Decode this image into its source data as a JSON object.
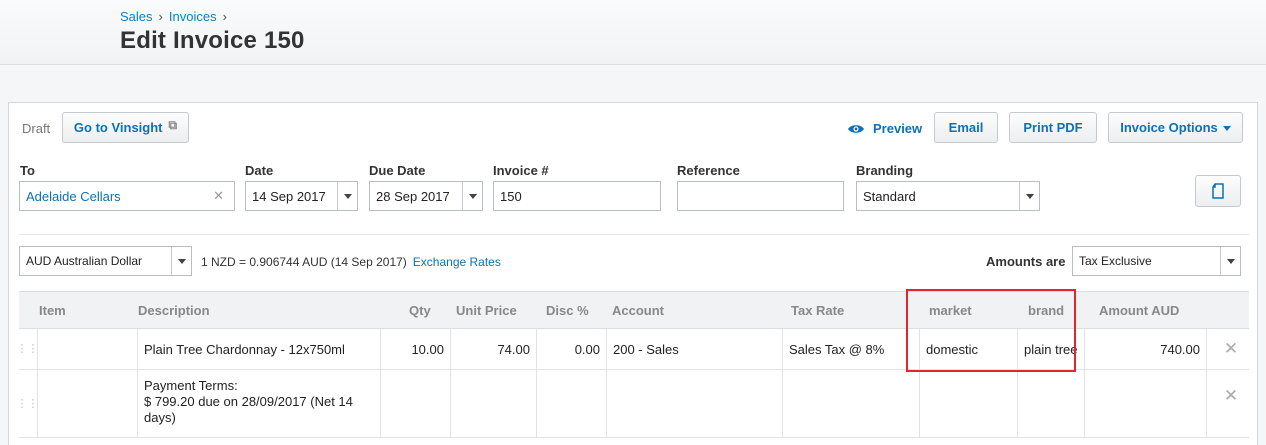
{
  "breadcrumb": {
    "items": [
      "Sales",
      "Invoices"
    ]
  },
  "page": {
    "title": "Edit Invoice 150"
  },
  "toolbar": {
    "status": "Draft",
    "go_to_vinsight": "Go to Vinsight",
    "preview": "Preview",
    "email": "Email",
    "print_pdf": "Print PDF",
    "invoice_options": "Invoice Options"
  },
  "form": {
    "to": {
      "label": "To",
      "value": "Adelaide Cellars"
    },
    "date": {
      "label": "Date",
      "value": "14 Sep 2017"
    },
    "due_date": {
      "label": "Due Date",
      "value": "28 Sep 2017"
    },
    "invoice_number": {
      "label": "Invoice #",
      "value": "150"
    },
    "reference": {
      "label": "Reference",
      "value": ""
    },
    "branding": {
      "label": "Branding",
      "value": "Standard"
    }
  },
  "currency": {
    "value": "AUD Australian Dollar",
    "rate_text": "1 NZD = 0.906744  AUD  (14 Sep 2017)",
    "exchange_rates_link": "Exchange Rates",
    "amounts_are_label": "Amounts are",
    "amounts_are_value": "Tax Exclusive"
  },
  "table": {
    "headers": {
      "item": "Item",
      "description": "Description",
      "qty": "Qty",
      "unit_price": "Unit Price",
      "disc": "Disc %",
      "account": "Account",
      "tax_rate": "Tax Rate",
      "market": "market",
      "brand": "brand",
      "amount": "Amount AUD"
    },
    "rows": [
      {
        "item": "",
        "description": "Plain Tree Chardonnay - 12x750ml",
        "qty": "10.00",
        "unit_price": "74.00",
        "disc": "0.00",
        "account": "200 - Sales",
        "tax_rate": "Sales Tax @ 8%",
        "market": "domestic",
        "brand": "plain tree",
        "amount": "740.00"
      },
      {
        "item": "",
        "description_lines": [
          "Payment Terms:",
          "$ 799.20 due on 28/09/2017 (Net 14",
          "days)"
        ],
        "qty": "",
        "unit_price": "",
        "disc": "",
        "account": "",
        "tax_rate": "",
        "market": "",
        "brand": "",
        "amount": ""
      }
    ]
  },
  "colors": {
    "link": "#0b72b5",
    "highlight": "#e0262f"
  },
  "icons": {
    "external": "external-link-icon",
    "preview": "eye-icon",
    "clear": "clear-icon",
    "delete": "delete-row-icon",
    "grip": "drag-handle-icon",
    "side": "document-icon"
  }
}
